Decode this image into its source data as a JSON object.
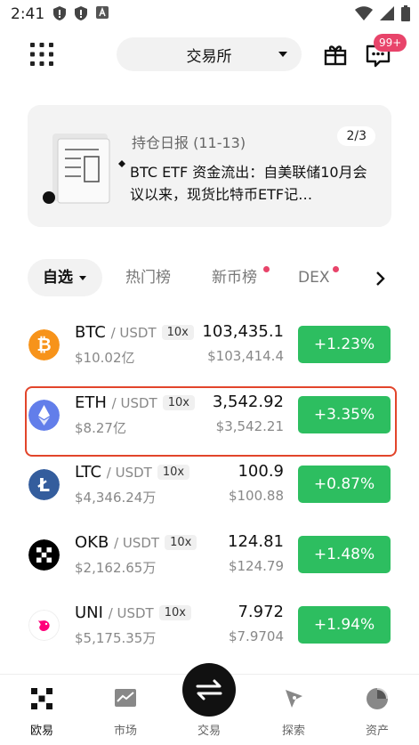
{
  "status_bar": {
    "time": "2:41"
  },
  "header": {
    "exchange_label": "交易所",
    "badge": "99+"
  },
  "banner": {
    "title": "持仓日报 (11-13)",
    "page": "2/3",
    "text": "BTC ETF 资金流出：自美联储10月会议以来，现货比特币ETF记…"
  },
  "tabs": [
    {
      "label": "自选",
      "active": true
    },
    {
      "label": "热门榜",
      "active": false
    },
    {
      "label": "新币榜",
      "active": false
    },
    {
      "label": "DEX",
      "active": false
    }
  ],
  "rows": [
    {
      "base": "BTC",
      "quote": "/ USDT",
      "leverage": "10x",
      "volume": "$10.02亿",
      "price": "103,435.1",
      "fiat": "$103,414.4",
      "change": "+1.23%",
      "icon_color": "#f7931a",
      "icon": "bitcoin-icon"
    },
    {
      "base": "ETH",
      "quote": "/ USDT",
      "leverage": "10x",
      "volume": "$8.27亿",
      "price": "3,542.92",
      "fiat": "$3,542.21",
      "change": "+3.35%",
      "icon_color": "#627eea",
      "icon": "ethereum-icon"
    },
    {
      "base": "LTC",
      "quote": "/ USDT",
      "leverage": "10x",
      "volume": "$4,346.24万",
      "price": "100.9",
      "fiat": "$100.88",
      "change": "+0.87%",
      "icon_color": "#345d9d",
      "icon": "litecoin-icon"
    },
    {
      "base": "OKB",
      "quote": "/ USDT",
      "leverage": "10x",
      "volume": "$2,162.65万",
      "price": "124.81",
      "fiat": "$124.79",
      "change": "+1.48%",
      "icon_color": "#000000",
      "icon": "okb-icon"
    },
    {
      "base": "UNI",
      "quote": "/ USDT",
      "leverage": "10x",
      "volume": "$5,175.35万",
      "price": "7.972",
      "fiat": "$7.9704",
      "change": "+1.94%",
      "icon_color": "#ff007a",
      "icon": "uniswap-icon"
    }
  ],
  "bottom_nav": [
    {
      "label": "欧易",
      "icon": "okx-logo-icon"
    },
    {
      "label": "市场",
      "icon": "market-chart-icon"
    },
    {
      "label": "交易",
      "icon": "trade-swap-icon"
    },
    {
      "label": "探索",
      "icon": "explore-compass-icon"
    },
    {
      "label": "资产",
      "icon": "assets-pie-icon"
    }
  ],
  "colors": {
    "up": "#2dbe60",
    "badge": "#e8446a",
    "highlight": "#e2452b"
  }
}
